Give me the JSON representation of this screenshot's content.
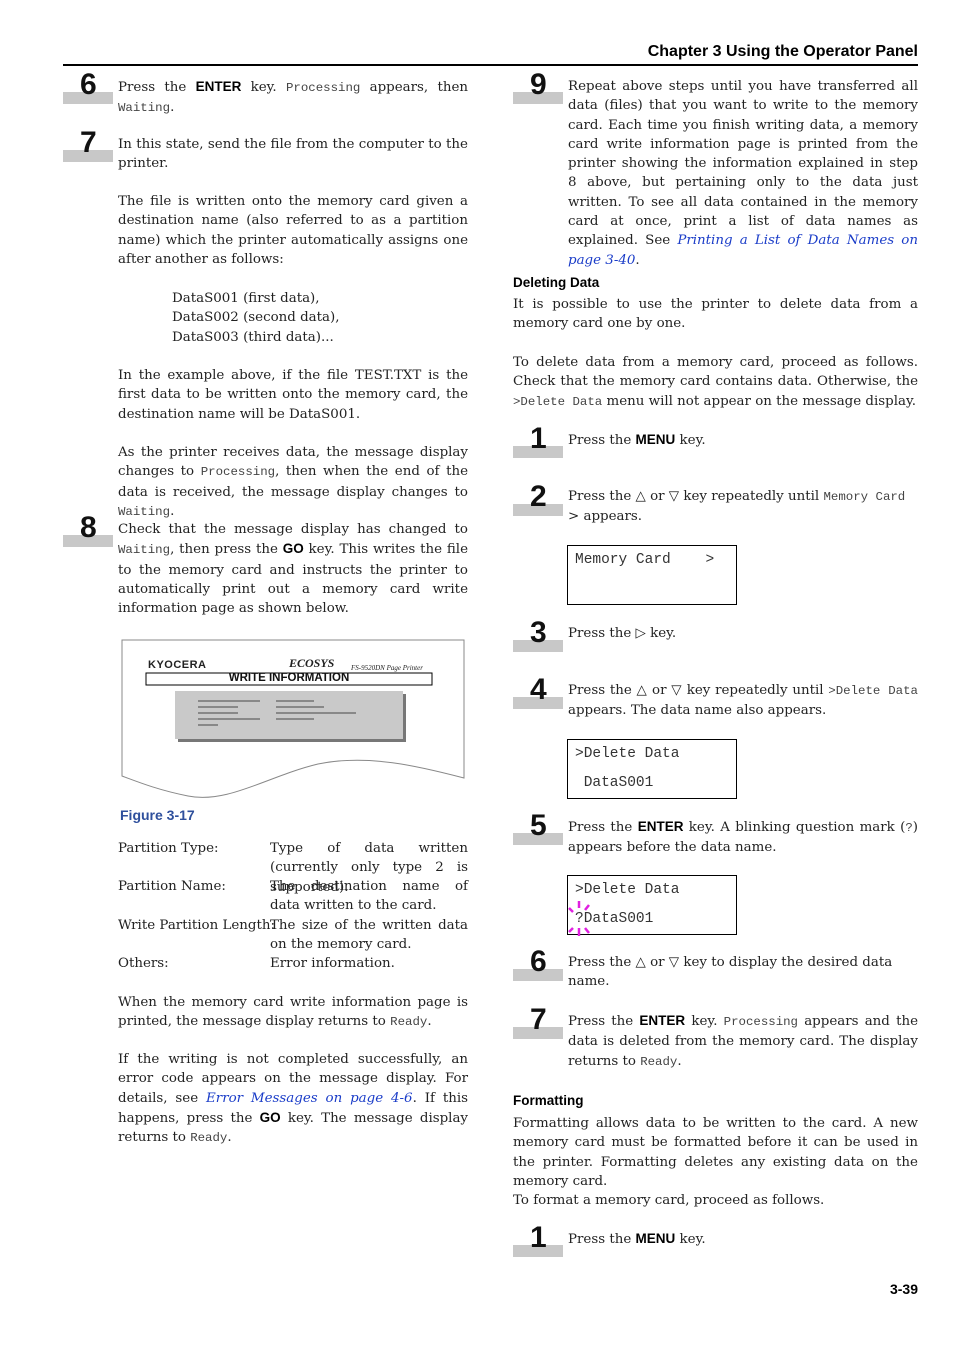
{
  "header": {
    "title": "Chapter 3  Using the Operator Panel"
  },
  "left": {
    "step6": {
      "num": "6",
      "a": "Press the ",
      "key": "ENTER",
      "b": " key. ",
      "m1": "Processing",
      "c": " appears, then ",
      "m2": "Waiting",
      "d": "."
    },
    "step7": {
      "num": "7",
      "text": "In this state, send the file from the computer to the printer."
    },
    "para1": "The file is written onto the memory card given a destination name (also referred to as a partition name) which the printer automatically assigns one after another as follows:",
    "names": [
      "DataS001 (first data),",
      "DataS002 (second data),",
      "DataS003 (third data)..."
    ],
    "para2": "In the example above, if the file TEST.TXT is the first data to be written onto the memory card, the destination name will be DataS001.",
    "para3": {
      "a": "As the printer receives data, the message display changes to ",
      "m1": "Processing",
      "b": ", then when the end of the data is received, the message display changes to ",
      "m2": "Waiting",
      "c": "."
    },
    "step8": {
      "num": "8",
      "a": "Check that the message display has changed to ",
      "m1": "Waiting",
      "b": ", then press the ",
      "key": "GO",
      "c": " key. This writes the file to the memory card and instructs the printer to automatically print out a memory card write information page as shown below."
    },
    "figure": {
      "brand": "KYOCERA",
      "ecosys": "ECOSYS",
      "model": "FS-9520DN  Page Printer",
      "title": "WRITE INFORMATION",
      "caption": "Figure 3-17"
    },
    "definitions": [
      {
        "term": "Partition Type:",
        "desc": "Type of data written (currently only type 2 is supported)."
      },
      {
        "term": "Partition Name:",
        "desc": "The destination name of data written to the card."
      },
      {
        "term": "Write Partition Length:",
        "desc": "The size of the written data on the memory card."
      },
      {
        "term": "Others:",
        "desc": "Error information."
      }
    ],
    "para4": {
      "a": "When the memory card write information page is printed, the message display returns to ",
      "m": "Ready",
      "b": "."
    },
    "para5": {
      "a": "If the writing is not completed successfully, an error code appears on the message display. For details, see ",
      "link": "Error Messages on page 4-6",
      "b": ". If this happens, press the ",
      "key": "GO",
      "c": " key. The message display returns to ",
      "m": "Ready",
      "d": "."
    }
  },
  "right": {
    "step9": {
      "num": "9",
      "text": "Repeat above steps until you have transferred all data (files) that you want to write to the memory card. Each time you finish writing data, a memory card write information page is printed from the printer showing the information explained in step 8 above, but pertaining only to the data just written. To see all data contained in the memory card at once, print a list of data names as explained. See ",
      "link": "Printing a List of Data Names on page 3-40",
      "end": "."
    },
    "deleting": {
      "heading": "Deleting Data",
      "intro": "It is possible to use the printer to delete data from a memory card one by one.",
      "para": {
        "a": "To delete data from a memory card, proceed as follows. Check that the memory card contains data. Otherwise, the ",
        "m": ">Delete Data",
        "b": " menu will not appear on the message display."
      },
      "steps": [
        {
          "num": "1",
          "a": "Press the ",
          "key": "MENU",
          "b": " key."
        },
        {
          "num": "2",
          "a": "Press the △ or ▽ key repeatedly until ",
          "m": "Memory Card",
          "b": " > appears."
        },
        {
          "num": "3",
          "a": "Press the ▷ key."
        },
        {
          "num": "4",
          "a": "Press the △ or ▽ key repeatedly until ",
          "m": ">Delete Data",
          "b": " appears. The data name also appears."
        },
        {
          "num": "5",
          "a": "Press the ",
          "key": "ENTER",
          "b": " key. A blinking question mark (",
          "m": "?",
          "c": ") appears before the data name."
        },
        {
          "num": "6",
          "a": "Press the △ or ▽ key to display the desired data name."
        },
        {
          "num": "7",
          "a": "Press the ",
          "key": "ENTER",
          "b": " key. ",
          "m1": "Processing",
          "c": " appears and the data is deleted from the memory card. The display returns to ",
          "m2": "Ready",
          "d": "."
        }
      ],
      "lcd1": {
        "line1": "Memory Card    >",
        "line2": ""
      },
      "lcd2": {
        "line1": ">Delete Data",
        "line2": " DataS001"
      },
      "lcd3": {
        "line1": ">Delete Data",
        "line2": "?DataS001"
      }
    },
    "formatting": {
      "heading": "Formatting",
      "intro": "Formatting allows data to be written to the card. A new memory card must be formatted before it can be used in the printer. Formatting deletes any existing data on the memory card.",
      "para": "To format a memory card, proceed as follows.",
      "step1": {
        "num": "1",
        "a": "Press the ",
        "key": "MENU",
        "b": " key."
      }
    }
  },
  "footer": {
    "page": "3-39"
  },
  "colors": {
    "link": "#1a3cc8",
    "caption": "#2e4f9c",
    "blink": "#e020e0",
    "step_bar": "#c8c8c8"
  }
}
